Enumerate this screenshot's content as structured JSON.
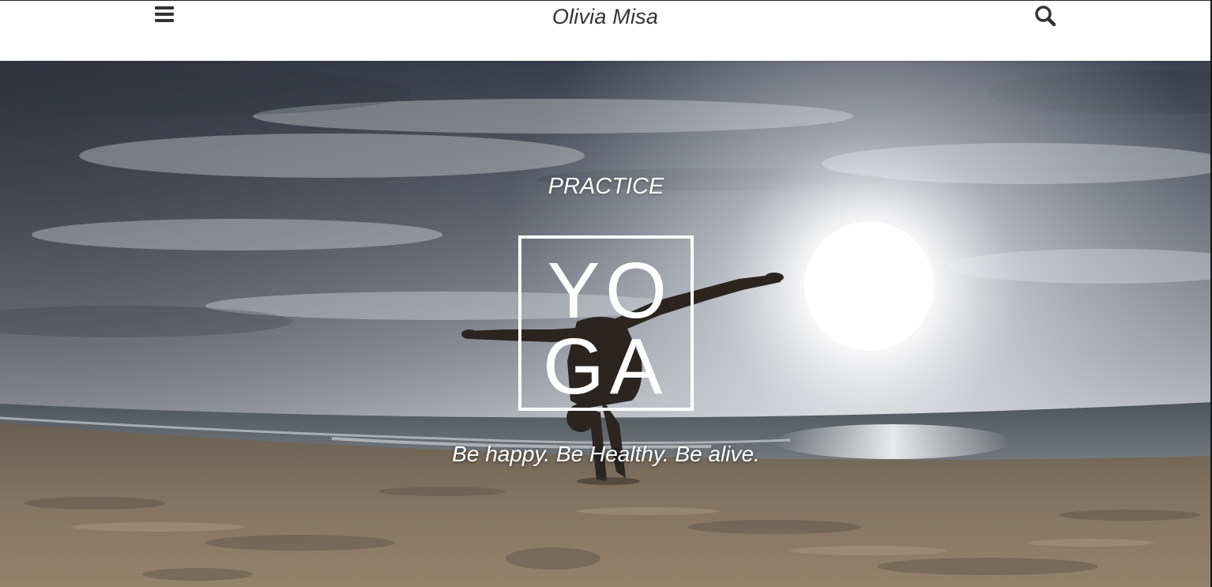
{
  "header": {
    "site_title": "Olivia Misa",
    "menu_icon": "hamburger-menu-icon",
    "search_icon": "search-icon"
  },
  "hero": {
    "kicker": "PRACTICE",
    "logo": {
      "letters": [
        "Y",
        "O",
        "G",
        "A"
      ]
    },
    "tagline": "Be happy. Be Healthy. Be alive.",
    "background_image": "silhouette of woman in arm-balance yoga pose on beach at sunset",
    "colors": {
      "text": "#ffffff",
      "sky_dark": "#3b3f4a",
      "sky_light": "#d9dde3",
      "sun": "#ffffff",
      "sand": "#8c7a63"
    }
  }
}
